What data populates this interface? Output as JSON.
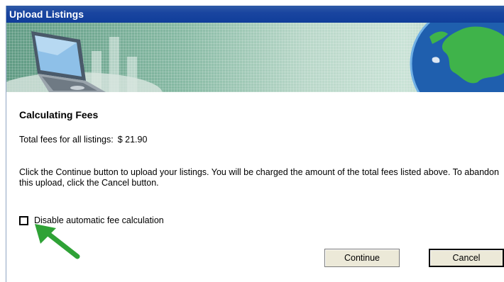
{
  "window": {
    "title": "Upload Listings"
  },
  "content": {
    "heading": "Calculating Fees",
    "total_label": "Total fees for all listings:",
    "total_value": "$ 21.90",
    "instructions": "Click the Continue button to upload your listings. You will be charged the amount of the total fees listed above. To abandon this upload, click the Cancel button.",
    "checkbox": {
      "label": "Disable automatic fee calculation",
      "checked": false
    }
  },
  "buttons": {
    "continue": "Continue",
    "cancel": "Cancel"
  },
  "icons": {
    "banner_left": "laptop-icon",
    "banner_right": "globe-icon",
    "annotation": "arrow-icon"
  },
  "colors": {
    "titlebar": "#1a45a0",
    "annotation_arrow": "#2fa236"
  }
}
